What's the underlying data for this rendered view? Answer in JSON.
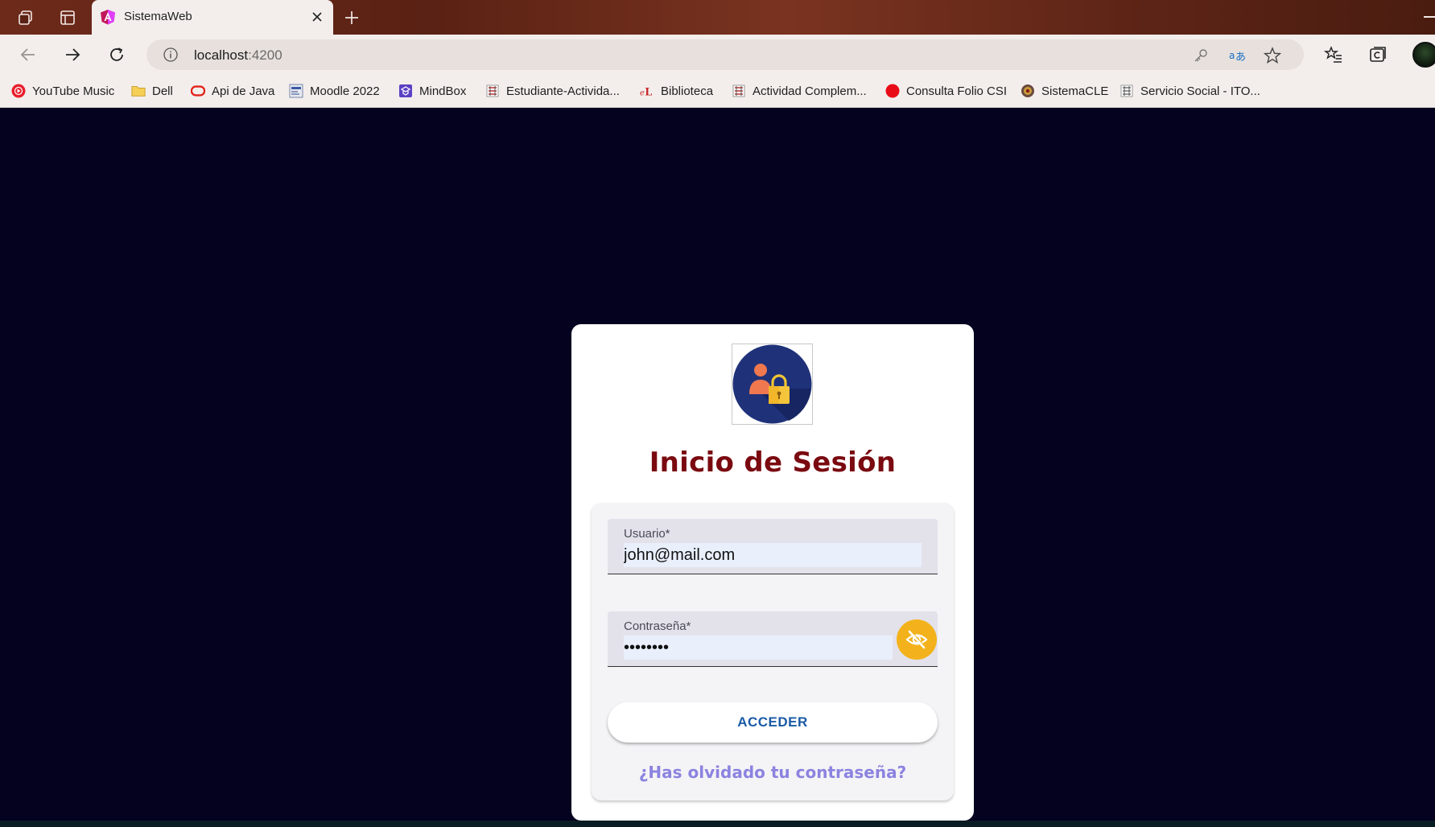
{
  "browser": {
    "tab_title": "SistemaWeb",
    "url_host": "localhost",
    "url_port": ":4200",
    "bookmarks": [
      {
        "label": "YouTube Music",
        "icon": "youtube-music-icon"
      },
      {
        "label": "Dell",
        "icon": "folder-icon"
      },
      {
        "label": "Api de Java",
        "icon": "oracle-icon"
      },
      {
        "label": "Moodle 2022",
        "icon": "moodle-icon"
      },
      {
        "label": "MindBox",
        "icon": "mindbox-icon"
      },
      {
        "label": "Estudiante-Activida...",
        "icon": "site-icon"
      },
      {
        "label": "Biblioteca",
        "icon": "library-icon"
      },
      {
        "label": "Actividad Complem...",
        "icon": "site-icon"
      },
      {
        "label": "Consulta Folio CSI",
        "icon": "red-dot-icon"
      },
      {
        "label": "SistemaCLE",
        "icon": "site-icon"
      },
      {
        "label": "Servicio Social - ITO...",
        "icon": "site-icon"
      }
    ]
  },
  "login": {
    "title": "Inicio de Sesión",
    "username_label": "Usuario*",
    "username_value": "john@mail.com",
    "password_label": "Contraseña*",
    "password_value": "••••••••",
    "submit_label": "ACCEDER",
    "forgot_label": "¿Has olvidado tu contraseña?"
  },
  "colors": {
    "page_bg": "#04021f",
    "title": "#7a0a10",
    "eye_button": "#f3b21b",
    "submit_text": "#1a5aa6",
    "forgot_link": "#8b83e0"
  }
}
